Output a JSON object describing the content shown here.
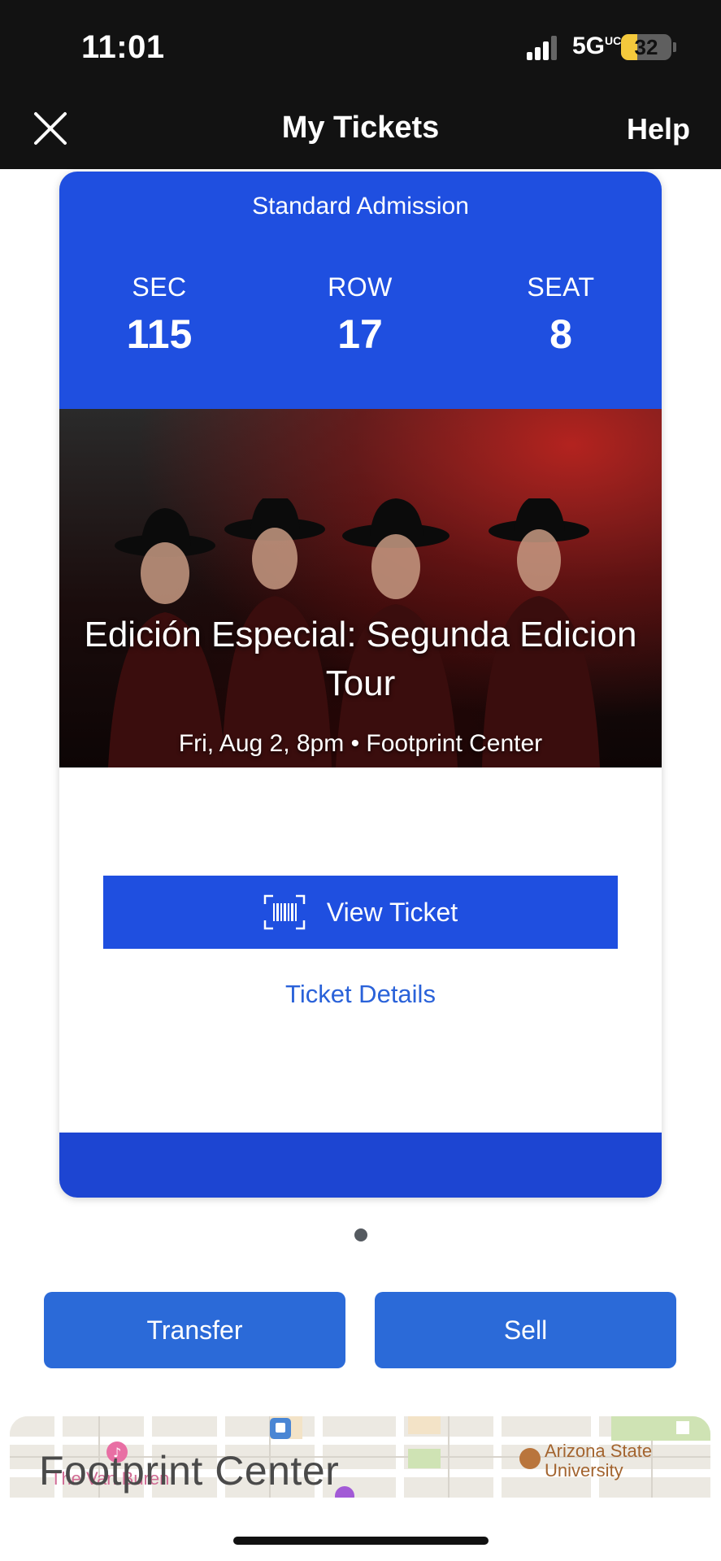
{
  "status_bar": {
    "time": "11:01",
    "network": "5G",
    "network_suffix": "UC",
    "battery_percent": "32",
    "battery_level": 0.32,
    "signal_icon": "signal-bars-icon",
    "battery_icon": "battery-icon"
  },
  "nav": {
    "title": "My Tickets",
    "help_label": "Help",
    "close_icon": "close-icon"
  },
  "ticket": {
    "admission": "Standard Admission",
    "section_label": "SEC",
    "section_value": "115",
    "row_label": "ROW",
    "row_value": "17",
    "seat_label": "SEAT",
    "seat_value": "8",
    "event_title": "Edición Especial: Segunda Edicion Tour",
    "event_subtitle": "Fri, Aug 2, 8pm • Footprint Center",
    "view_ticket_label": "View Ticket",
    "view_ticket_icon": "barcode-scan-icon",
    "ticket_details_label": "Ticket Details",
    "accent_color": "#1f4fe0"
  },
  "pagination": {
    "current": 1,
    "total": 1
  },
  "actions": {
    "transfer_label": "Transfer",
    "sell_label": "Sell",
    "button_color": "#2b6ad8"
  },
  "map": {
    "venue_label": "Footprint Center",
    "poi_1": "The Van Buren",
    "poi_2": "Arizona State",
    "poi_3": "University"
  }
}
